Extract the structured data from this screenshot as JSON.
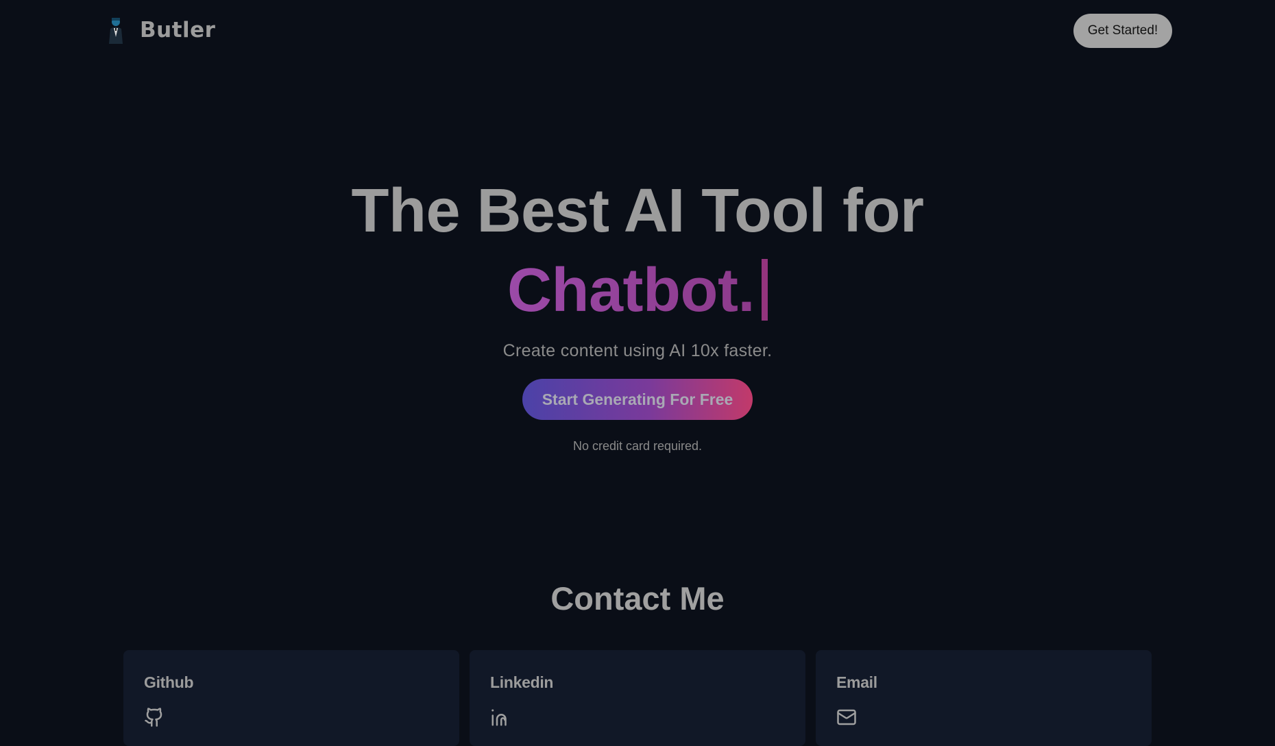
{
  "header": {
    "brand_name": "Butler",
    "cta_label": "Get Started!"
  },
  "hero": {
    "headline_line1": "The Best AI Tool for",
    "typed_word": "Chatbot.",
    "subtitle": "Create content using AI 10x faster.",
    "cta_label": "Start Generating For Free",
    "note": "No credit card required."
  },
  "contact": {
    "title": "Contact Me",
    "cards": [
      {
        "title": "Github",
        "icon": "github-icon"
      },
      {
        "title": "Linkedin",
        "icon": "linkedin-icon"
      },
      {
        "title": "Email",
        "icon": "mail-icon"
      }
    ]
  },
  "colors": {
    "background": "#0a0e17",
    "card_background": "#111827",
    "text_gray": "#9c9c9c",
    "accent_purple": "#93347d",
    "gradient_start": "#4b42a8",
    "gradient_end": "#c23a6a"
  }
}
